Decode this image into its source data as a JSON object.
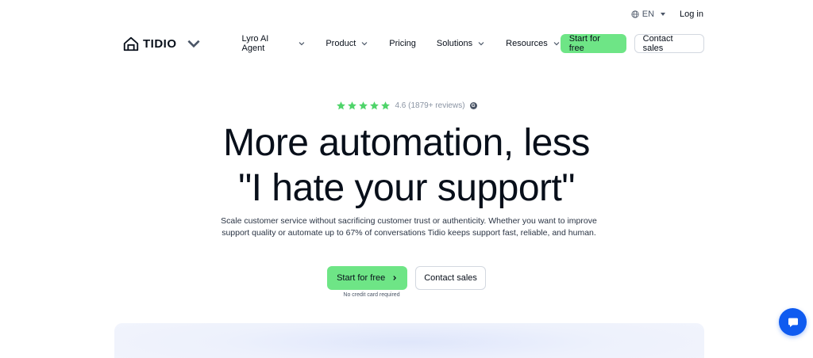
{
  "topbar": {
    "language": "EN",
    "login": "Log in"
  },
  "nav": {
    "brand": "TIDIO",
    "items": [
      {
        "label": "Lyro AI Agent",
        "has_dropdown": true
      },
      {
        "label": "Product",
        "has_dropdown": true
      },
      {
        "label": "Pricing",
        "has_dropdown": false
      },
      {
        "label": "Solutions",
        "has_dropdown": true
      },
      {
        "label": "Resources",
        "has_dropdown": true
      }
    ],
    "start_label": "Start for free",
    "contact_label": "Contact sales"
  },
  "hero": {
    "rating": {
      "stars": 5,
      "text": "4.6 (1879+ reviews)",
      "badge": "G"
    },
    "headline_line1": "More automation, less",
    "headline_line2": "\"I hate your support\"",
    "subtext": "Scale customer service without sacrificing customer trust or authenticity. Whether you want to improve support quality or automate up to 67% of conversations Tidio keeps support fast, reliable, and human.",
    "cta_primary": "Start for free",
    "cta_secondary": "Contact sales",
    "note": "No credit card required"
  },
  "colors": {
    "accent_green": "#6ee586",
    "chat_blue": "#0f5bf0",
    "star_green": "#4fd46a",
    "text_dark": "#080f1a"
  },
  "icons": {
    "globe": "globe-icon",
    "chevron": "chevron-down-icon",
    "star": "star-icon",
    "arrow": "chevron-right-icon",
    "chat": "chat-icon"
  }
}
